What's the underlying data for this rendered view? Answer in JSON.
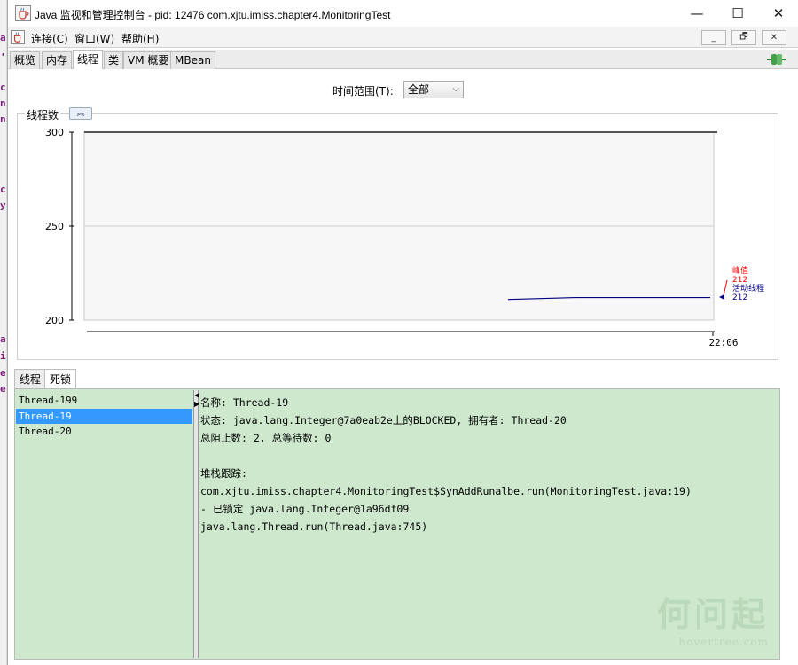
{
  "window": {
    "title": "Java 监视和管理控制台 - pid: 12476 com.xjtu.imiss.chapter4.MonitoringTest",
    "controls": {
      "minimize": "—",
      "maximize": "☐",
      "close": "✕"
    }
  },
  "menubar": {
    "items": [
      "连接(C)",
      "窗口(W)",
      "帮助(H)"
    ],
    "mdi_controls": [
      "_",
      "🗗",
      "✕"
    ]
  },
  "tabs": [
    {
      "label": "概览",
      "active": false
    },
    {
      "label": "内存",
      "active": false
    },
    {
      "label": "线程",
      "active": true
    },
    {
      "label": "类",
      "active": false
    },
    {
      "label": "VM 概要",
      "active": false
    },
    {
      "label": "MBean",
      "active": false
    }
  ],
  "time_range": {
    "label": "时间范围(T):",
    "selected": "全部"
  },
  "chart_panel": {
    "label": "线程数",
    "collapse_icon": "chevron-double-up-icon"
  },
  "chart_data": {
    "type": "line",
    "title": "",
    "ylim": [
      200,
      300
    ],
    "yticks": [
      "300",
      "250",
      "200"
    ],
    "xticks": [
      "22:06"
    ],
    "series": [
      {
        "name": "峰值",
        "color": "#ff0000",
        "current": "212"
      },
      {
        "name": "活动线程",
        "color": "#000080",
        "current": "212"
      }
    ],
    "active_series_values": [
      211,
      212,
      212,
      212
    ]
  },
  "subtabs": [
    {
      "label": "线程",
      "active": false
    },
    {
      "label": "死锁",
      "active": true
    }
  ],
  "threads": [
    {
      "name": "Thread-199",
      "selected": false
    },
    {
      "name": "Thread-19",
      "selected": true
    },
    {
      "name": "Thread-20",
      "selected": false
    }
  ],
  "details": {
    "lines": [
      "名称: Thread-19",
      "状态: java.lang.Integer@7a0eab2e上的BLOCKED, 拥有者: Thread-20",
      "总阻止数: 2, 总等待数: 0",
      "",
      "堆栈跟踪:",
      "com.xjtu.imiss.chapter4.MonitoringTest$SynAddRunalbe.run(MonitoringTest.java:19)",
      "   - 已锁定 java.lang.Integer@1a96df09",
      "java.lang.Thread.run(Thread.java:745)"
    ]
  },
  "watermark": {
    "big": "何问起",
    "small": "hovertree.com"
  },
  "left_strip_chars": [
    "a",
    "'",
    "c",
    "n",
    "n",
    "c",
    "y",
    "a",
    "i",
    "e",
    "e"
  ],
  "colors": {
    "accent": "#3399ff",
    "panel_bg": "#cde8cd",
    "peak": "#ff0000",
    "active": "#000080"
  }
}
